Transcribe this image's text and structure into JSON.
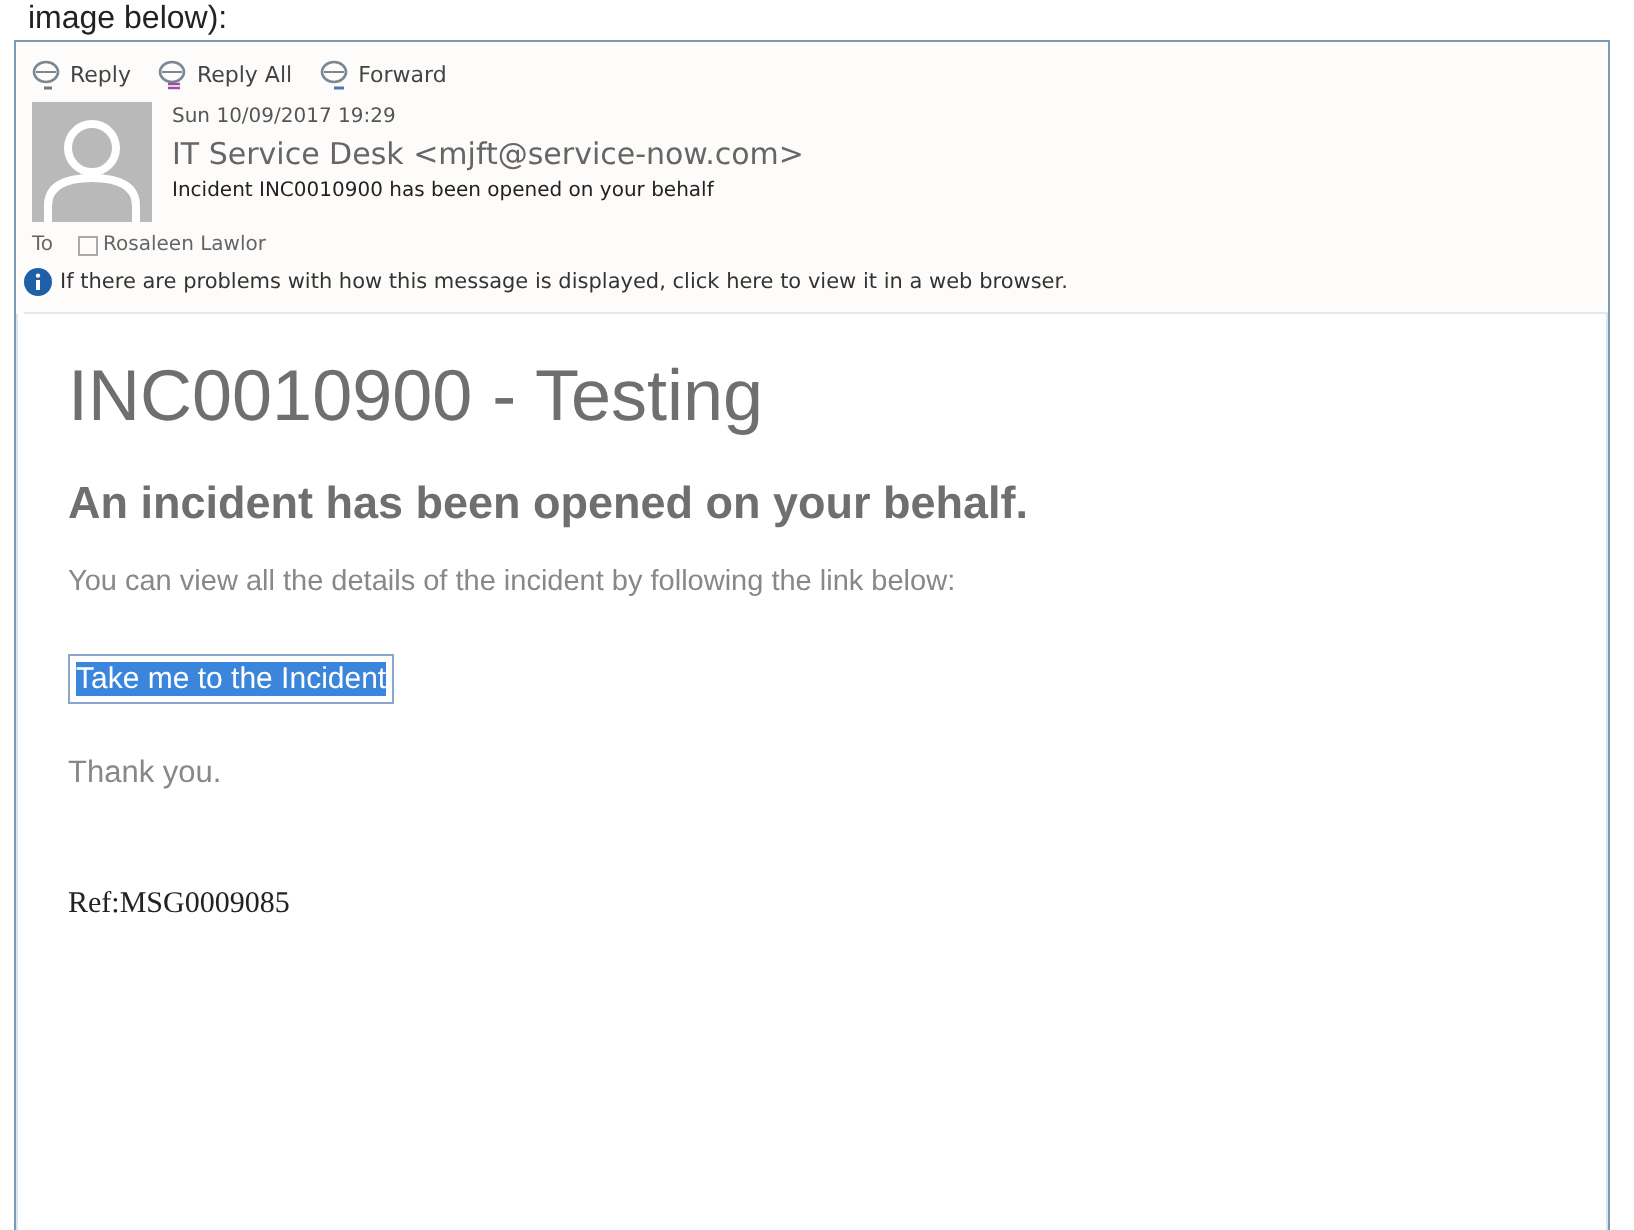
{
  "page_text": "image below):",
  "toolbar": [
    {
      "label": "Reply",
      "kind": "reply"
    },
    {
      "label": "Reply All",
      "kind": "replyall"
    },
    {
      "label": "Forward",
      "kind": "forward"
    }
  ],
  "message": {
    "date": "Sun 10/09/2017 19:29",
    "sender": "IT Service Desk <mjft@service-now.com>",
    "subject": "Incident INC0010900 has been opened on your behalf",
    "to_label": "To",
    "recipients": [
      "Rosaleen Lawlor"
    ],
    "info": "If there are problems with how this message is displayed, click here to view it in a web browser."
  },
  "body": {
    "title": "INC0010900 - Testing",
    "heading": "An incident has been opened on your behalf.",
    "intro": "You can view all the details of the incident by following the link below:",
    "link": {
      "label": "Take me to the Incident",
      "selected": true
    },
    "thanks": "Thank you.",
    "ref": "Ref:MSG0009085"
  }
}
